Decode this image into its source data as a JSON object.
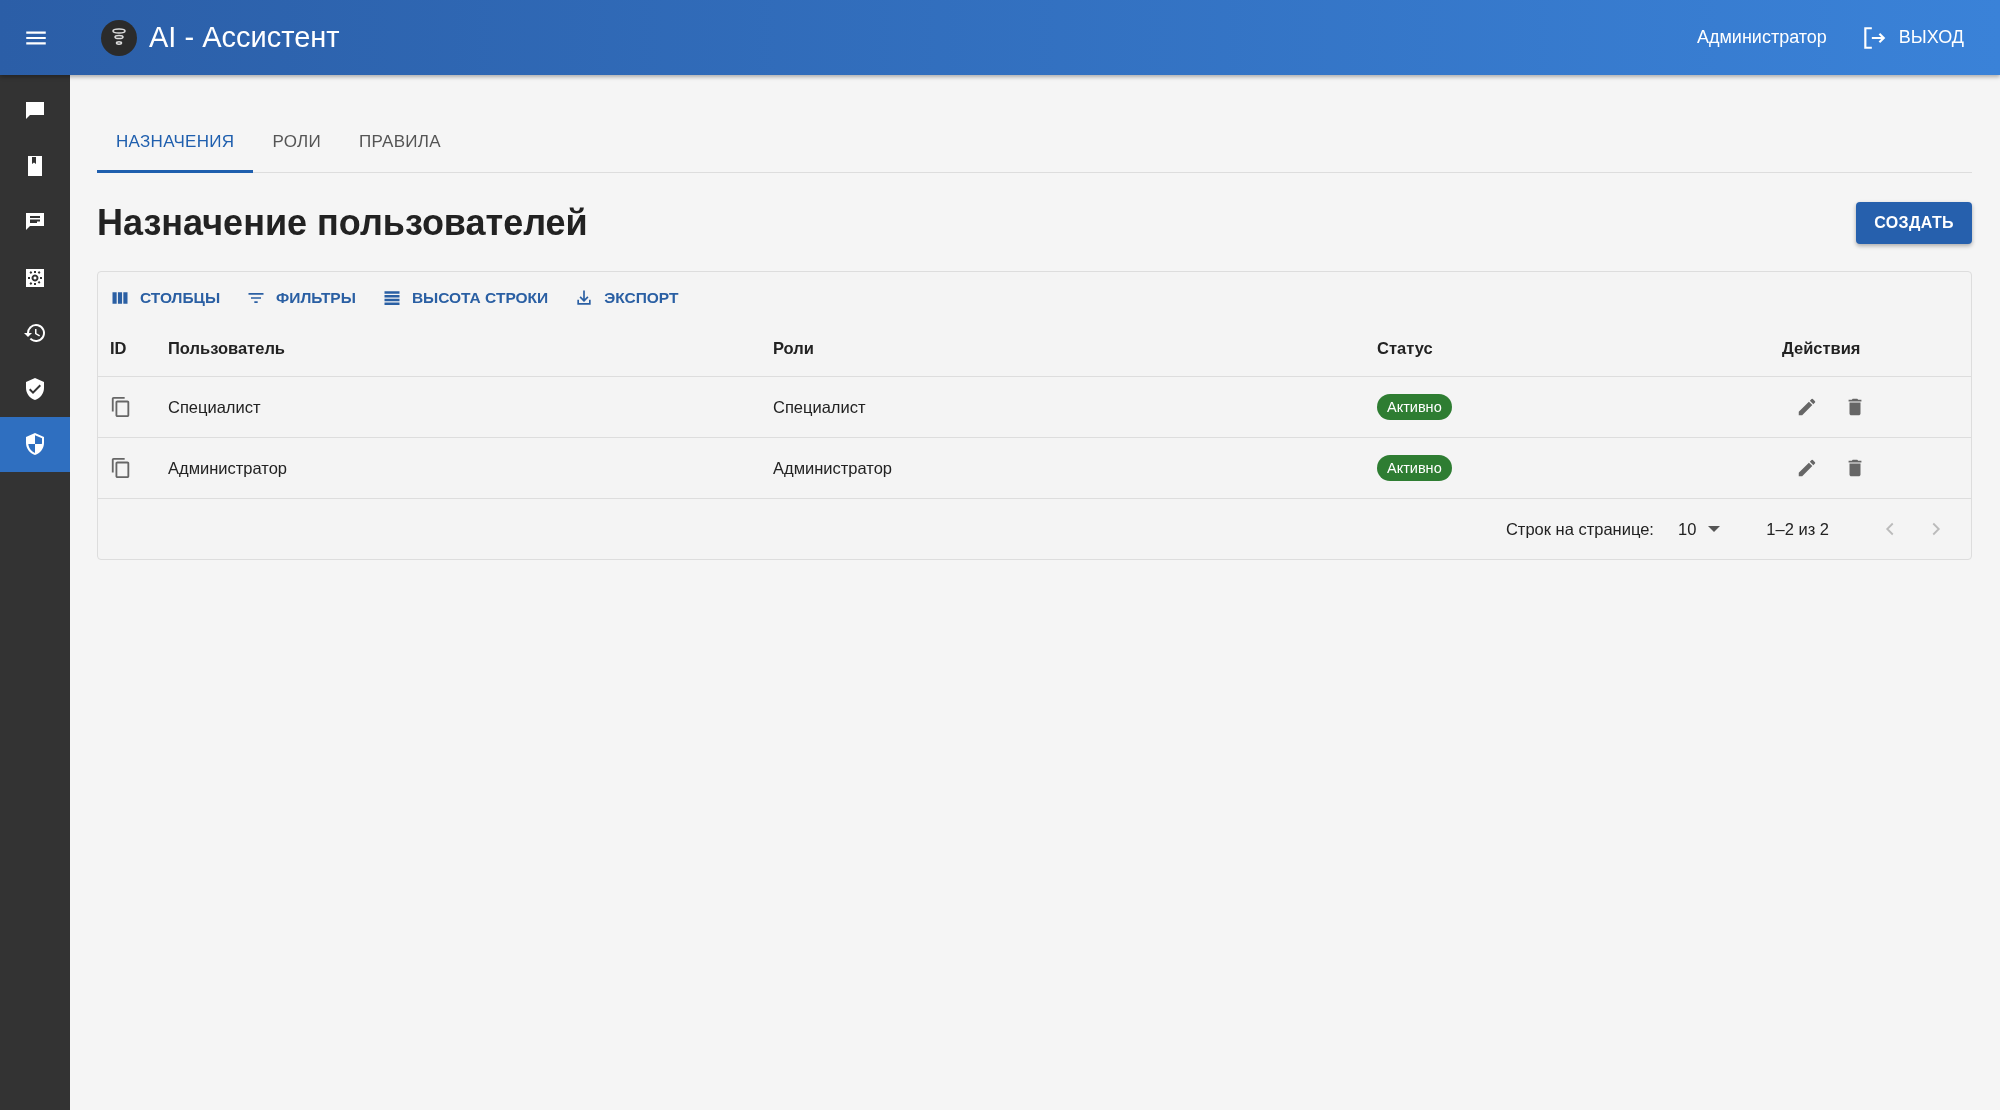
{
  "app_bar": {
    "title": "AI - Ассистент",
    "user": "Администратор",
    "logout": "ВЫХОД"
  },
  "sidebar": {
    "items": [
      {
        "selected": false
      },
      {
        "selected": false
      },
      {
        "selected": false
      },
      {
        "selected": false
      },
      {
        "selected": false
      },
      {
        "selected": false
      },
      {
        "selected": true
      }
    ]
  },
  "tabs": [
    {
      "label": "НАЗНАЧЕНИЯ",
      "selected": true
    },
    {
      "label": "РОЛИ",
      "selected": false
    },
    {
      "label": "ПРАВИЛА",
      "selected": false
    }
  ],
  "page_title": "Назначение пользователей",
  "create_button": "СОЗДАТЬ",
  "toolbar": [
    {
      "kind": "columns",
      "label": "СТОЛБЦЫ"
    },
    {
      "kind": "filters",
      "label": "ФИЛЬТРЫ"
    },
    {
      "kind": "density",
      "label": "ВЫСОТА СТРОКИ"
    },
    {
      "kind": "export",
      "label": "ЭКСПОРТ"
    }
  ],
  "table": {
    "columns": [
      "ID",
      "Пользователь",
      "Роли",
      "Статус",
      "Действия"
    ],
    "rows": [
      {
        "user": "Специалист",
        "roles": "Специалист",
        "status": "Активно"
      },
      {
        "user": "Администратор",
        "roles": "Администратор",
        "status": "Активно"
      }
    ]
  },
  "pagination": {
    "rows_per_page_label": "Строк на странице:",
    "rows_per_page": "10",
    "range": "1–2 из 2"
  }
}
